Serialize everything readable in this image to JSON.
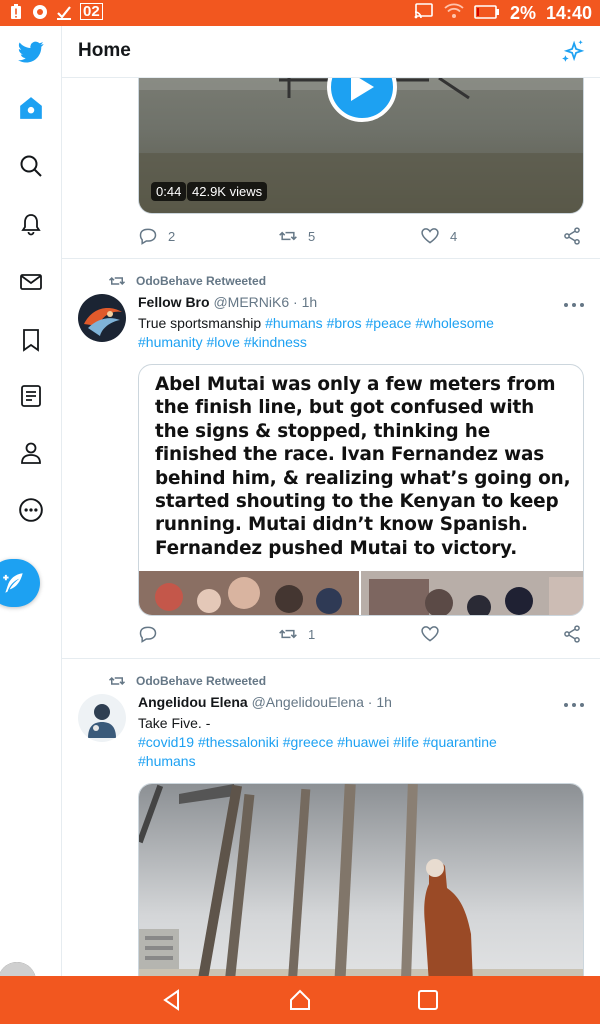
{
  "status_bar": {
    "notification_count": "02",
    "battery_percent": "2%",
    "time": "14:40"
  },
  "header": {
    "title": "Home"
  },
  "tweets": [
    {
      "video_duration": "0:44",
      "video_views": "42.9K views",
      "replies": "2",
      "retweets": "5",
      "likes": "4"
    },
    {
      "retweeted_by": "OdoBehave Retweeted",
      "display_name": "Fellow Bro",
      "handle": "@MERNiK6",
      "time": "· 1h",
      "text_prefix": "True sportsmanship",
      "hashtags_line1": [
        "#humans",
        "#bros",
        "#peace",
        "#wholesome"
      ],
      "hashtags_line2": [
        "#humanity",
        "#love",
        "#kindness"
      ],
      "image_text": "Abel Mutai was only a few meters from the finish line, but got confused with the signs & stopped, thinking he finished the race. Ivan Fernandez was behind him, & realizing what’s going on, started shouting to the Kenyan to keep running. Mutai didn’t know Spanish. Fernandez pushed Mutai to victory.",
      "retweets": "1"
    },
    {
      "retweeted_by": "OdoBehave Retweeted",
      "display_name": "Angelidou Elena",
      "handle": "@AngelidouElena",
      "time": "· 1h",
      "text": "Take Five. -",
      "hashtags_line1": [
        "#covid19",
        "#thessaloniki",
        "#greece",
        "#huawei",
        "#life",
        "#quarantine"
      ],
      "hashtags_line2": [
        "#humans"
      ]
    }
  ],
  "colors": {
    "accent": "#1da1f2",
    "system_bar": "#f2571f",
    "secondary_text": "#657786"
  }
}
